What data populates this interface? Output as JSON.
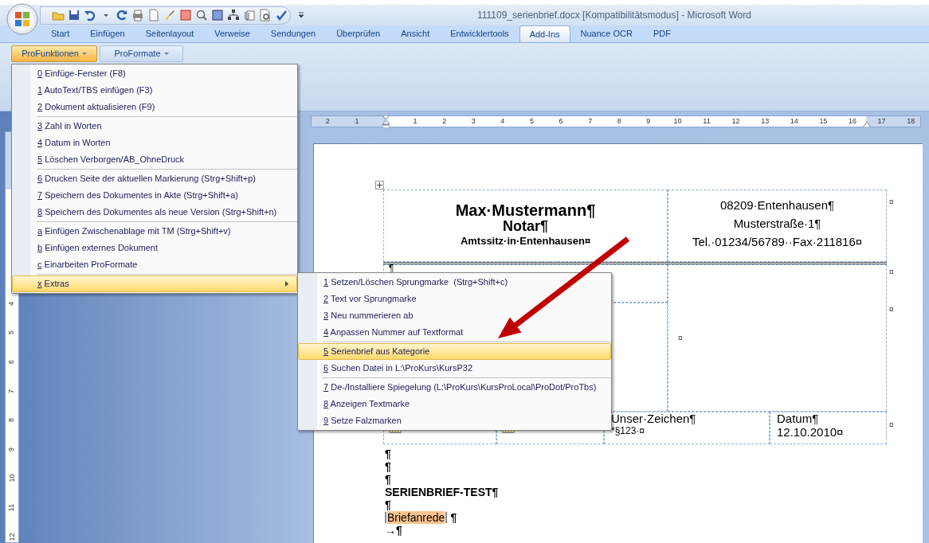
{
  "window": {
    "title": "111109_serienbrief.docx [Kompatibilitätsmodus] - Microsoft Word"
  },
  "ribbon_tabs": [
    {
      "label": "Start",
      "selected": false
    },
    {
      "label": "Einfügen",
      "selected": false
    },
    {
      "label": "Seitenlayout",
      "selected": false
    },
    {
      "label": "Verweise",
      "selected": false
    },
    {
      "label": "Sendungen",
      "selected": false
    },
    {
      "label": "Überprüfen",
      "selected": false
    },
    {
      "label": "Ansicht",
      "selected": false
    },
    {
      "label": "Entwicklertools",
      "selected": false
    },
    {
      "label": "Add-Ins",
      "selected": true
    },
    {
      "label": "Nuance OCR",
      "selected": false
    },
    {
      "label": "PDF",
      "selected": false
    }
  ],
  "ribbon_buttons": [
    {
      "label": "ProFunktionen",
      "selected": true
    },
    {
      "label": "ProFormate",
      "selected": false
    }
  ],
  "ruler": {
    "left_labels": [
      "2",
      "1"
    ],
    "labels": [
      "1",
      "2",
      "3",
      "4",
      "5",
      "6",
      "7",
      "8",
      "9",
      "10",
      "11",
      "12",
      "13",
      "14",
      "15",
      "16",
      "17",
      "18"
    ]
  },
  "vertical_ruler": {
    "labels": [
      "4",
      "5",
      "6",
      "7",
      "8",
      "9",
      "10",
      "11",
      "12"
    ]
  },
  "menu": {
    "groups": [
      [
        {
          "key": "0",
          "label": "Einfüge-Fenster (F8)",
          "selected": false,
          "submenu": false
        },
        {
          "key": "1",
          "label": "AutoText/TBS einfügen (F3)",
          "selected": false,
          "submenu": false
        },
        {
          "key": "2",
          "label": "Dokument aktualisieren (F9)",
          "selected": false,
          "submenu": false
        }
      ],
      [
        {
          "key": "3",
          "label": "Zahl in Worten",
          "selected": false,
          "submenu": false
        },
        {
          "key": "4",
          "label": "Datum in Worten",
          "selected": false,
          "submenu": false
        },
        {
          "key": "5",
          "label": "Löschen Verborgen/AB_OhneDruck",
          "selected": false,
          "submenu": false
        }
      ],
      [
        {
          "key": "6",
          "label": "Drucken Seite der aktuellen Markierung (Strg+Shift+p)",
          "selected": false,
          "submenu": false
        },
        {
          "key": "7",
          "label": "Speichern des Dokumentes in Akte (Strg+Shift+a)",
          "selected": false,
          "submenu": false
        },
        {
          "key": "8",
          "label": "Speichern des Dokumentes als neue Version (Strg+Shift+n)",
          "selected": false,
          "submenu": false
        }
      ],
      [
        {
          "key": "a",
          "label": "Einfügen Zwischenablage mit TM (Strg+Shift+v)",
          "selected": false,
          "submenu": false
        },
        {
          "key": "b",
          "label": "Einfügen externes Dokument",
          "selected": false,
          "submenu": false
        },
        {
          "key": "c",
          "label": "Einarbeiten ProFormate",
          "selected": false,
          "submenu": false
        }
      ],
      [
        {
          "key": "x",
          "label": "Extras",
          "selected": true,
          "submenu": true
        }
      ]
    ]
  },
  "submenu": {
    "groups": [
      [
        {
          "key": "1",
          "label": "Setzen/Löschen Sprungmarke  (Strg+Shift+c)",
          "selected": false
        },
        {
          "key": "2",
          "label": "Text vor Sprungmarke",
          "selected": false
        },
        {
          "key": "3",
          "label": "Neu nummerieren ab",
          "selected": false
        },
        {
          "key": "4",
          "label": "Anpassen Nummer auf Textformat",
          "selected": false
        }
      ],
      [
        {
          "key": "5",
          "label": "Serienbrief aus Kategorie",
          "selected": true
        },
        {
          "key": "6",
          "label": "Suchen Datei in L:\\ProKurs\\KursP32",
          "selected": false
        }
      ],
      [
        {
          "key": "7",
          "label": "De-/Installiere Spiegelung (L:\\ProKurs\\KursProLocal\\ProDot/ProTbs)",
          "selected": false
        },
        {
          "key": "8",
          "label": "Anzeigen Textmarke",
          "selected": false
        },
        {
          "key": "9",
          "label": "Setze Falzmarken",
          "selected": false
        }
      ]
    ]
  },
  "document": {
    "letterhead": {
      "name": "Max·Mustermann¶",
      "title": "Notar¶",
      "seat": "Amtssitz·in·Entenhausen¤",
      "address": [
        "08209·Entenhausen¶",
        "Musterstraße·1¶",
        "Tel.·01234/56789··Fax·211816¤"
      ]
    },
    "row_marks": [
      "¤",
      "¤",
      "¤",
      "¤"
    ],
    "middle": {
      "left_mark": "¶",
      "right_mark": "¤"
    },
    "reference_row": [
      {
        "kind": "field"
      },
      {
        "kind": "field"
      },
      {
        "kind": "text",
        "lines": [
          "Unser·Zeichen¶",
          "*§123·¤"
        ]
      },
      {
        "kind": "text",
        "lines": [
          "Datum¶",
          "12.10.2010¤"
        ]
      }
    ],
    "body": [
      {
        "kind": "mark",
        "text": "¶"
      },
      {
        "kind": "mark",
        "text": "¶"
      },
      {
        "kind": "mark",
        "text": "¶"
      },
      {
        "kind": "heading",
        "text": "SERIENBRIEF-TEST¶"
      },
      {
        "kind": "mark",
        "text": "¶"
      },
      {
        "kind": "field",
        "field": "Briefanrede",
        "text": "¶"
      },
      {
        "kind": "mark",
        "text": "→¶"
      }
    ]
  }
}
